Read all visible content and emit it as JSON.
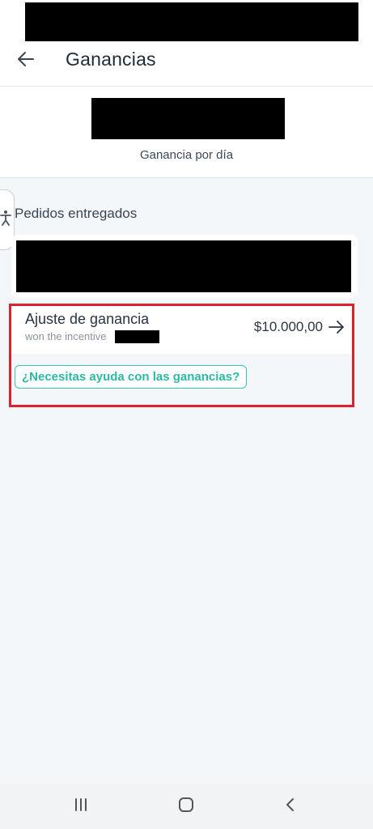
{
  "header": {
    "title": "Ganancias",
    "back_icon": "arrow-left-icon"
  },
  "summary": {
    "per_day_label": "Ganancia por día"
  },
  "accessibility": {
    "icon": "accessibility-icon"
  },
  "delivered": {
    "section_title": "Pedidos entregados"
  },
  "adjustment": {
    "title": "Ajuste de ganancia",
    "subtitle": "won the incentive",
    "amount": "$10.000,00",
    "arrow_icon": "arrow-right-icon"
  },
  "help": {
    "label": "¿Necesitas ayuda con las ganancias?"
  },
  "colors": {
    "accent": "#2bb9a4",
    "highlight": "#d9242b",
    "background": "#f4f7fa"
  },
  "system_nav": {
    "recents_icon": "recents-icon",
    "home_icon": "home-icon",
    "back_icon": "chevron-left-icon"
  }
}
